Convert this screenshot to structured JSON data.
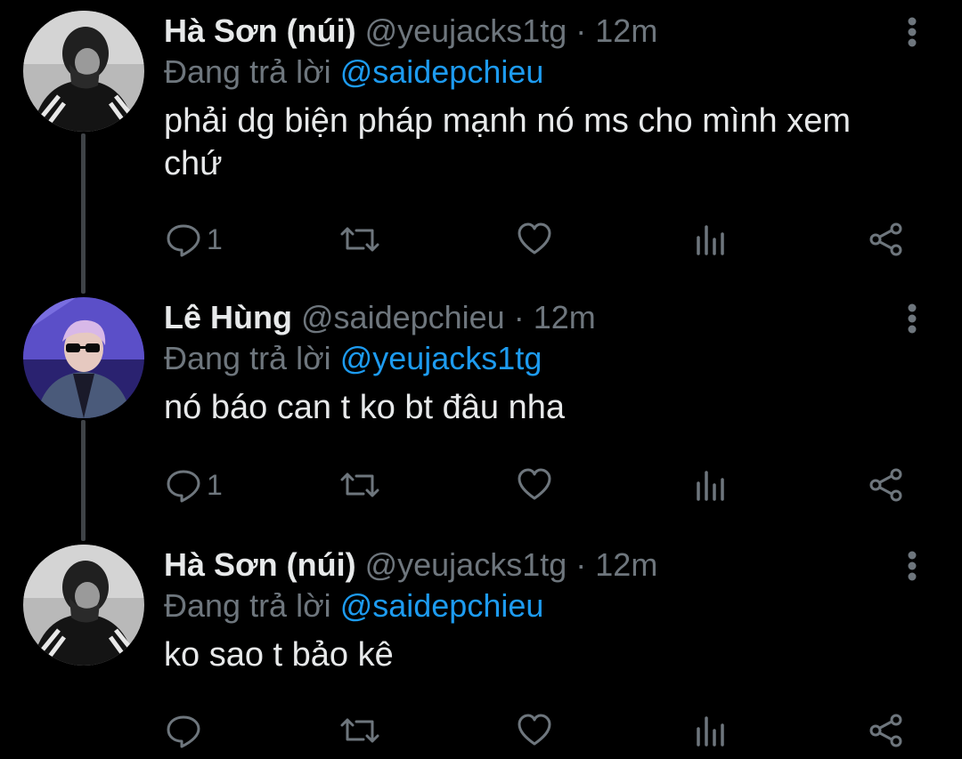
{
  "colors": {
    "background": "#000000",
    "text": "#e7e9ea",
    "muted": "#6e767d",
    "link": "#1d9bf0",
    "thread_line": "#3f4347"
  },
  "tweets": [
    {
      "name": "Hà Sơn (núi)",
      "handle": "@yeujacks1tg",
      "separator": "·",
      "time": "12m",
      "reply_prefix": "Đang trả lời",
      "reply_to": "@saidepchieu",
      "text": "phải dg biện pháp mạnh nó ms cho mình xem chứ",
      "reply_count": "1",
      "avatar": "user-avatar-bw-hoodie"
    },
    {
      "name": "Lê Hùng",
      "handle": "@saidepchieu",
      "separator": "·",
      "time": "12m",
      "reply_prefix": "Đang trả lời",
      "reply_to": "@yeujacks1tg",
      "text": "nó báo can t ko bt đâu nha",
      "reply_count": "1",
      "avatar": "user-avatar-purple-sunglasses"
    },
    {
      "name": "Hà Sơn (núi)",
      "handle": "@yeujacks1tg",
      "separator": "·",
      "time": "12m",
      "reply_prefix": "Đang trả lời",
      "reply_to": "@saidepchieu",
      "text": "ko sao t bảo kê",
      "reply_count": "",
      "avatar": "user-avatar-bw-hoodie"
    }
  ],
  "icons": {
    "menu": "more-vertical-icon",
    "reply": "reply-icon",
    "retweet": "retweet-icon",
    "like": "heart-icon",
    "analytics": "analytics-icon",
    "share": "share-icon"
  }
}
